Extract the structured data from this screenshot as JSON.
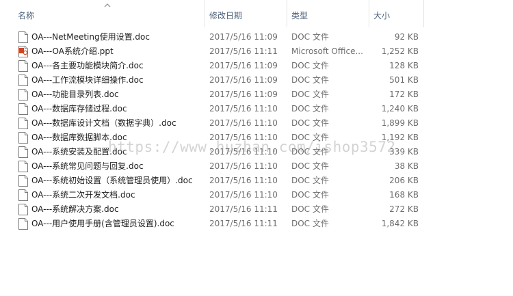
{
  "columns": {
    "name": "名称",
    "date": "修改日期",
    "type": "类型",
    "size": "大小"
  },
  "sort": {
    "column": "name",
    "direction": "ascending"
  },
  "files": [
    {
      "name": "OA---NetMeeting使用设置.doc",
      "date": "2017/5/16 11:09",
      "type": "DOC 文件",
      "size": "92 KB",
      "icon": "doc-file-icon"
    },
    {
      "name": "OA---OA系统介绍.ppt",
      "date": "2017/5/16 11:11",
      "type": "Microsoft Office...",
      "size": "1,252 KB",
      "icon": "ppt-file-icon"
    },
    {
      "name": "OA---各主要功能模块简介.doc",
      "date": "2017/5/16 11:09",
      "type": "DOC 文件",
      "size": "128 KB",
      "icon": "doc-file-icon"
    },
    {
      "name": "OA---工作流模块详细操作.doc",
      "date": "2017/5/16 11:09",
      "type": "DOC 文件",
      "size": "501 KB",
      "icon": "doc-file-icon"
    },
    {
      "name": "OA---功能目录列表.doc",
      "date": "2017/5/16 11:09",
      "type": "DOC 文件",
      "size": "172 KB",
      "icon": "doc-file-icon"
    },
    {
      "name": "OA---数据库存储过程.doc",
      "date": "2017/5/16 11:10",
      "type": "DOC 文件",
      "size": "1,240 KB",
      "icon": "doc-file-icon"
    },
    {
      "name": "OA---数据库设计文档（数据字典）.doc",
      "date": "2017/5/16 11:10",
      "type": "DOC 文件",
      "size": "1,899 KB",
      "icon": "doc-file-icon"
    },
    {
      "name": "OA---数据库数据脚本.doc",
      "date": "2017/5/16 11:10",
      "type": "DOC 文件",
      "size": "1,192 KB",
      "icon": "doc-file-icon"
    },
    {
      "name": "OA---系统安装及配置.doc",
      "date": "2017/5/16 11:10",
      "type": "DOC 文件",
      "size": "339 KB",
      "icon": "doc-file-icon"
    },
    {
      "name": "OA---系统常见问题与回复.doc",
      "date": "2017/5/16 11:10",
      "type": "DOC 文件",
      "size": "38 KB",
      "icon": "doc-file-icon"
    },
    {
      "name": "OA---系统初始设置（系统管理员使用）.doc",
      "date": "2017/5/16 11:10",
      "type": "DOC 文件",
      "size": "206 KB",
      "icon": "doc-file-icon"
    },
    {
      "name": "OA---系统二次开发文档.doc",
      "date": "2017/5/16 11:10",
      "type": "DOC 文件",
      "size": "168 KB",
      "icon": "doc-file-icon"
    },
    {
      "name": "OA---系统解决方案.doc",
      "date": "2017/5/16 11:11",
      "type": "DOC 文件",
      "size": "272 KB",
      "icon": "doc-file-icon"
    },
    {
      "name": "OA---用户使用手册(含管理员设置).doc",
      "date": "2017/5/16 11:11",
      "type": "DOC 文件",
      "size": "1,842 KB",
      "icon": "doc-file-icon"
    }
  ],
  "watermark": "https://www.huzhan.com/ishop3572"
}
